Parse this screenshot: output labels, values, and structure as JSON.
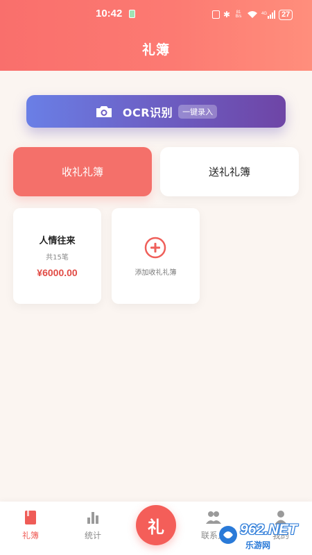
{
  "status_bar": {
    "time": "10:42",
    "net_speed": "81 B/s",
    "network": "4G",
    "battery": "27"
  },
  "header": {
    "title": "礼簿"
  },
  "ocr": {
    "label": "OCR识别",
    "tag": "一键录入"
  },
  "tabs": {
    "receive": "收礼礼簿",
    "send": "送礼礼簿"
  },
  "books": [
    {
      "name": "人情往来",
      "count": "共15笔",
      "amount": "¥6000.00"
    }
  ],
  "add_card": {
    "label": "添加收礼礼簿"
  },
  "nav": {
    "ledger": "礼簿",
    "stats": "统计",
    "fab": "礼",
    "contacts": "联系人",
    "mine": "我的"
  },
  "watermark": {
    "number": "962.NET",
    "site": "乐游网"
  },
  "colors": {
    "accent": "#f4706a",
    "amount": "#e14b45",
    "ocr_gradient_start": "#6a7fe6",
    "ocr_gradient_end": "#6e45a6",
    "background": "#fbf5f1"
  }
}
